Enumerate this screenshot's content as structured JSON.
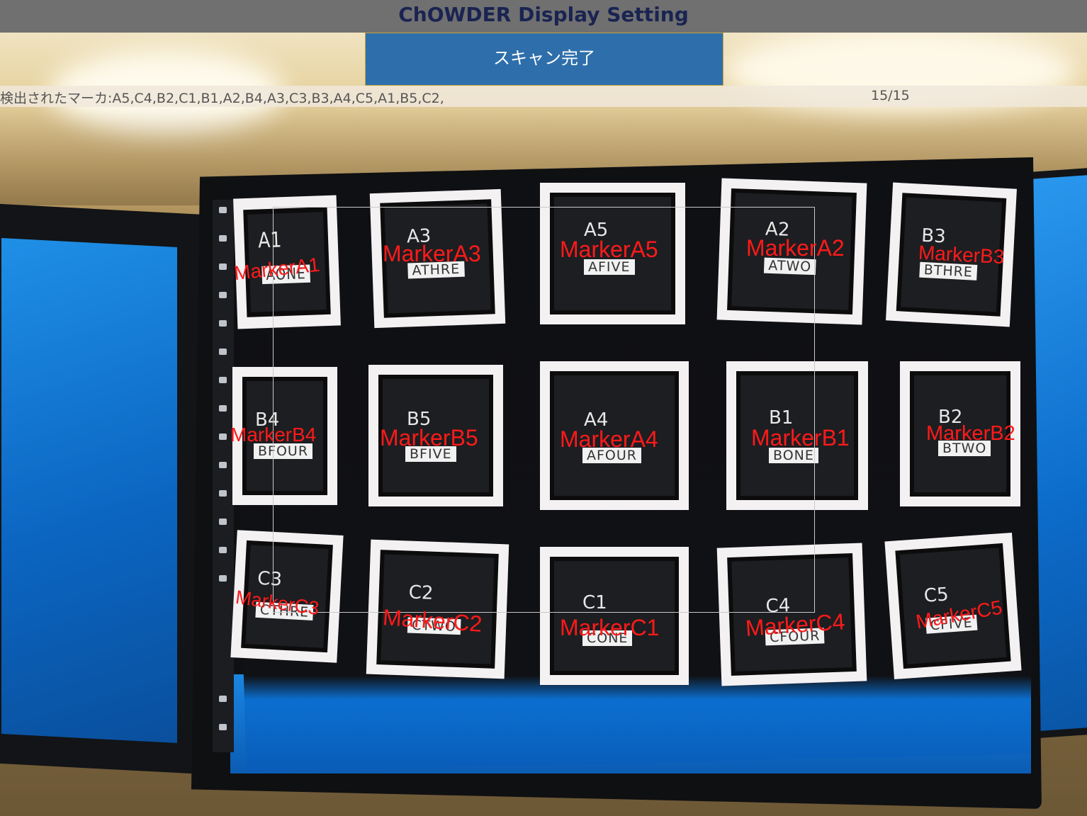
{
  "app": {
    "title": "ChOWDER Display Setting"
  },
  "scan_button": {
    "label": "スキャン完了"
  },
  "status": {
    "detected_markers": "検出されたマーカ:A5,C4,B2,C1,B1,A2,B4,A3,C3,B3,A4,C5,A1,B5,C2,",
    "count": "15/15"
  },
  "markers": [
    {
      "code": "A1",
      "word": "AONE",
      "label": "MarkerA1"
    },
    {
      "code": "A3",
      "word": "ATHRE",
      "label": "MarkerA3"
    },
    {
      "code": "A5",
      "word": "AFIVE",
      "label": "MarkerA5"
    },
    {
      "code": "A2",
      "word": "ATWO",
      "label": "MarkerA2"
    },
    {
      "code": "B3",
      "word": "BTHRE",
      "label": "MarkerB3"
    },
    {
      "code": "B4",
      "word": "BFOUR",
      "label": "MarkerB4"
    },
    {
      "code": "B5",
      "word": "BFIVE",
      "label": "MarkerB5"
    },
    {
      "code": "A4",
      "word": "AFOUR",
      "label": "MarkerA4"
    },
    {
      "code": "B1",
      "word": "BONE",
      "label": "MarkerB1"
    },
    {
      "code": "B2",
      "word": "BTWO",
      "label": "MarkerB2"
    },
    {
      "code": "C3",
      "word": "CTHRE",
      "label": "MarkerC3"
    },
    {
      "code": "C2",
      "word": "CTWO",
      "label": "MarkerC2"
    },
    {
      "code": "C1",
      "word": "CONE",
      "label": "MarkerC1"
    },
    {
      "code": "C4",
      "word": "CFOUR",
      "label": "MarkerC4"
    },
    {
      "code": "C5",
      "word": "CFIVE",
      "label": "MarkerC5"
    }
  ],
  "colors": {
    "title_bar": "#707070",
    "title_text": "#1a2452",
    "button_bg": "#2e6fab",
    "marker_label": "#ff1a1a"
  }
}
